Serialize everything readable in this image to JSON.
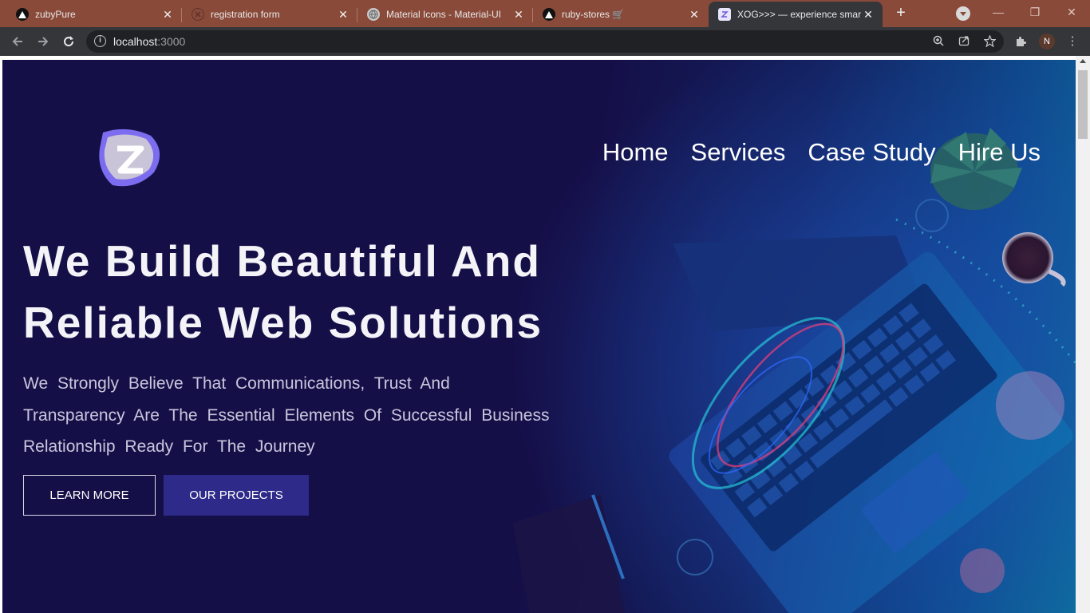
{
  "browser": {
    "tabs": [
      {
        "title": "zubyPure",
        "favicon": "vercel-triangle-icon",
        "active": false
      },
      {
        "title": "registration form",
        "favicon": "error-globe-icon",
        "active": false
      },
      {
        "title": "Material Icons - Material-UI",
        "favicon": "globe-icon",
        "active": false
      },
      {
        "title": "ruby-stores 🛒",
        "favicon": "vercel-triangle-icon",
        "active": false
      },
      {
        "title": "XOG>>> — experience smar",
        "favicon": "page-icon",
        "active": true
      }
    ],
    "new_tab": "+",
    "window_controls": {
      "minimize": "—",
      "restore": "❐",
      "close": "✕"
    },
    "address": {
      "host": "localhost",
      "port": ":3000"
    },
    "profile_initial": "N"
  },
  "site": {
    "nav": [
      "Home",
      "Services",
      "Case Study",
      "Hire Us"
    ],
    "headline_line1": "We Build Beautiful And",
    "headline_line2": "Reliable Web Solutions",
    "subtext": "We Strongly Believe That Communications, Trust And Transparency Are The Essential Elements Of Successful Business Relationship Ready For The Journey",
    "buttons": {
      "learn_more": "LEARN MORE",
      "our_projects": "OUR PROJECTS"
    }
  },
  "colors": {
    "hero_bg": "#150f48",
    "accent_button": "#2d2a8a",
    "tabstrip": "#8a4a3a",
    "logo_purple": "#7b6cf0"
  }
}
